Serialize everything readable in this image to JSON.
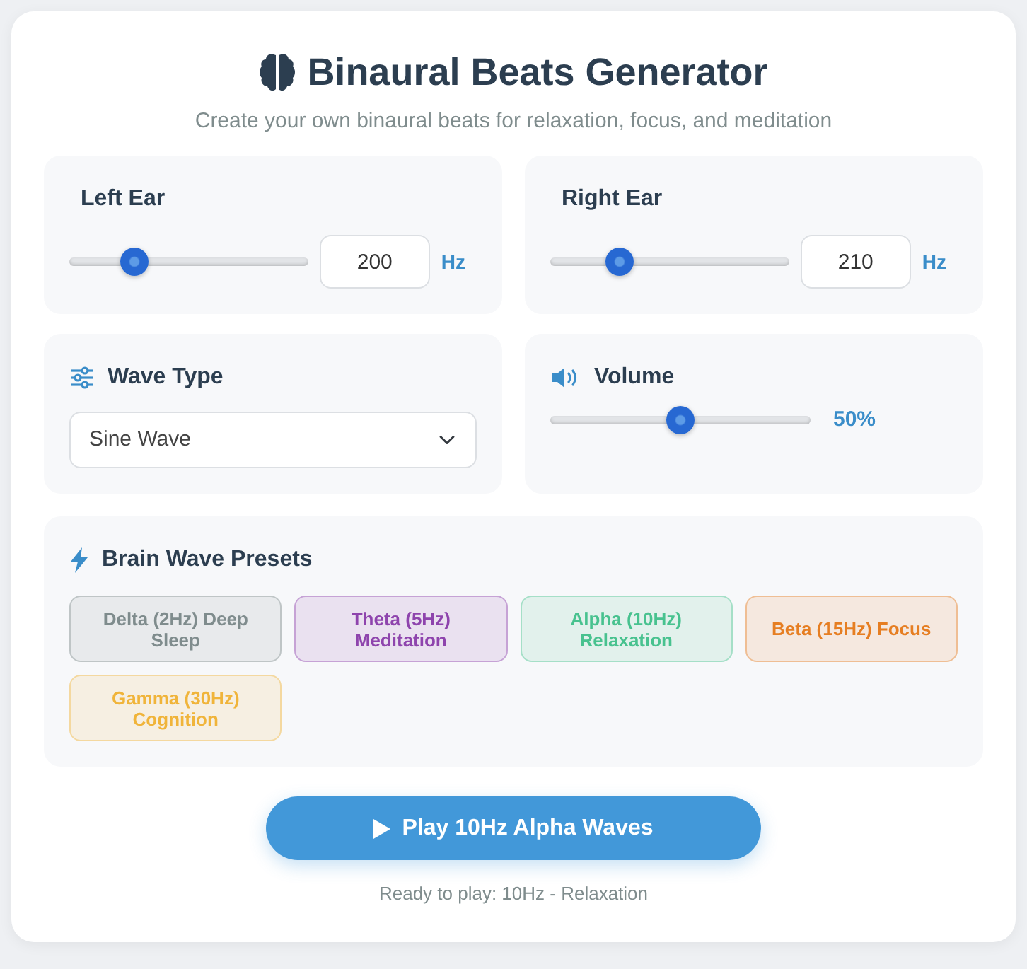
{
  "header": {
    "title": "Binaural Beats Generator",
    "subtitle": "Create your own binaural beats for relaxation, focus, and meditation"
  },
  "ears": [
    {
      "label": "Left Ear",
      "level": 0.24,
      "value": "200",
      "unit": "Hz"
    },
    {
      "label": "Right Ear",
      "level": 0.26,
      "value": "210",
      "unit": "Hz"
    }
  ],
  "wave_type": {
    "label": "Wave Type",
    "value": "Sine Wave"
  },
  "volume": {
    "label": "Volume",
    "level": 0.5,
    "reading": "50%"
  },
  "presets": {
    "title": "Brain Wave Presets",
    "items": [
      {
        "label": "Delta (2Hz) Deep Sleep",
        "color": "#7f8c8d"
      },
      {
        "label": "Theta (5Hz) Meditation",
        "color": "#8e44ad"
      },
      {
        "label": "Alpha (10Hz) Relaxation",
        "color": "#48c28f"
      },
      {
        "label": "Beta (15Hz) Focus",
        "color": "#e67e22"
      },
      {
        "label": "Gamma (30Hz) Cognition",
        "color": "#f0b43a"
      }
    ]
  },
  "play_button": {
    "label": "Play 10Hz Alpha Waves"
  },
  "status": "Ready to play: 10Hz - Relaxation"
}
